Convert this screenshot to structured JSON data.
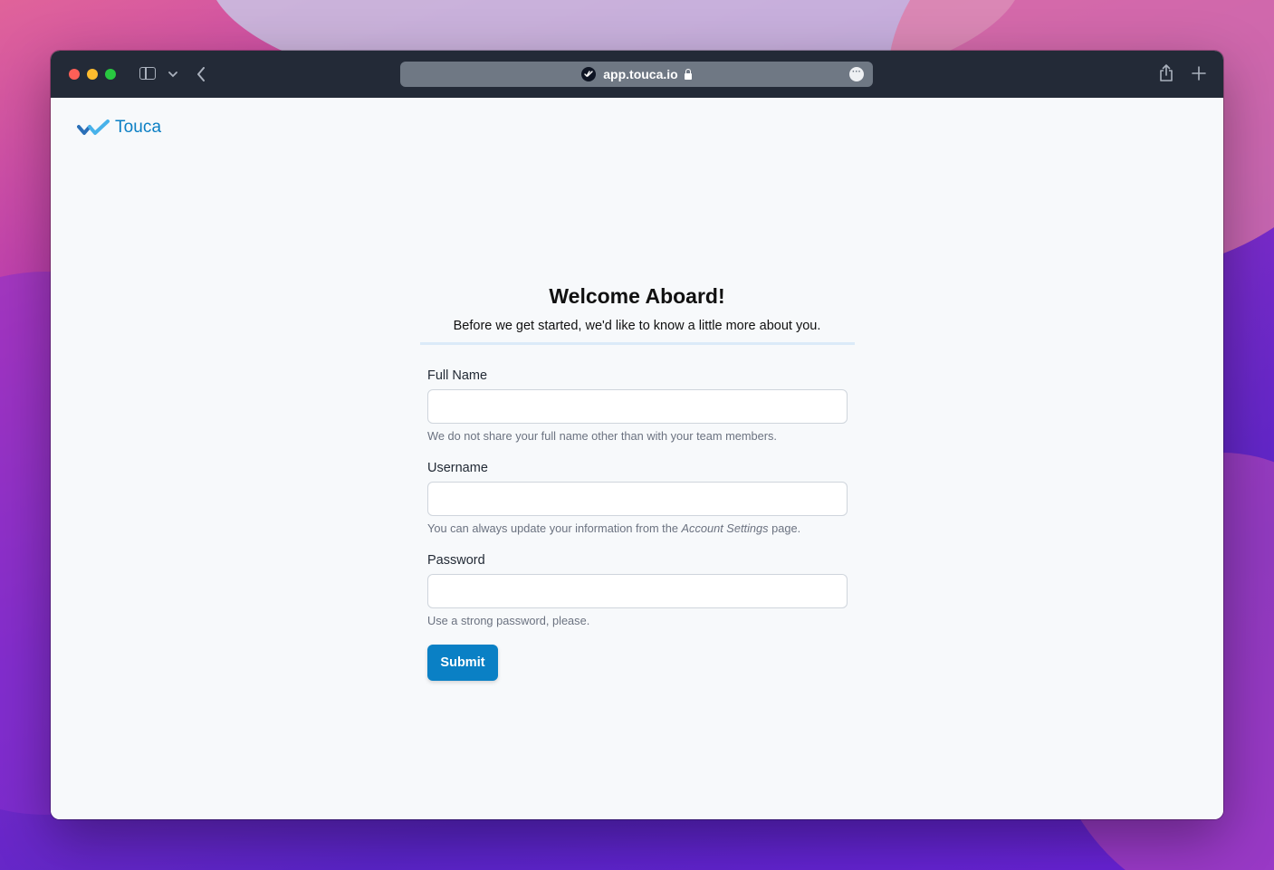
{
  "browser": {
    "url": "app.touca.io",
    "icons": [
      "sidebar-icon",
      "chevron-down-icon",
      "back-icon",
      "lock-icon",
      "more-icon",
      "share-icon",
      "plus-icon"
    ]
  },
  "header": {
    "logo_text": "Touca"
  },
  "form": {
    "title": "Welcome Aboard!",
    "subtitle": "Before we get started, we'd like to know a little more about you.",
    "fullname": {
      "label": "Full Name",
      "value": "",
      "help": "We do not share your full name other than with your team members."
    },
    "username": {
      "label": "Username",
      "value": "",
      "help_before": "You can always update your information from the ",
      "help_link": "Account Settings",
      "help_after": " page."
    },
    "password": {
      "label": "Password",
      "value": "",
      "help": "Use a strong password, please."
    },
    "submit_label": "Submit"
  },
  "colors": {
    "accent": "#0a80c5",
    "titlebar": "#232a37",
    "page_bg": "#f7f9fb"
  }
}
